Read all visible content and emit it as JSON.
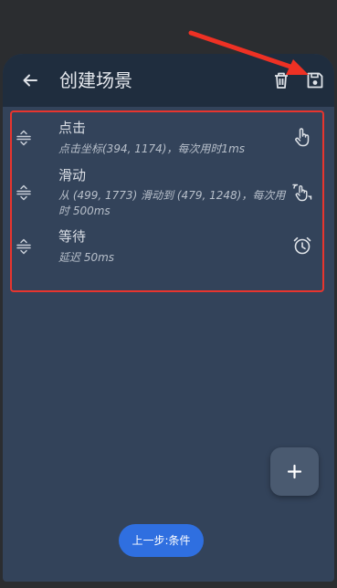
{
  "appbar": {
    "title": "创建场景",
    "icons": [
      "back-arrow-icon",
      "trash-icon",
      "save-icon"
    ]
  },
  "steps": [
    {
      "title": "点击",
      "desc": "点击坐标(394, 1174)，每次用时1ms",
      "icon": "tap-hand-icon"
    },
    {
      "title": "滑动",
      "desc": "从 (499, 1773) 滑动到 (479, 1248)，每次用时 500ms",
      "icon": "swipe-hand-icon"
    },
    {
      "title": "等待",
      "desc": "延迟 50ms",
      "icon": "alarm-clock-icon"
    }
  ],
  "fab": {
    "icon": "plus-icon"
  },
  "footer": {
    "prev_label": "上一步:条件"
  },
  "colors": {
    "appbar_bg": "#1f2d3e",
    "content_bg": "#33435a",
    "accent_blue": "#2f6fe0",
    "annotation_red": "#e8352e"
  }
}
